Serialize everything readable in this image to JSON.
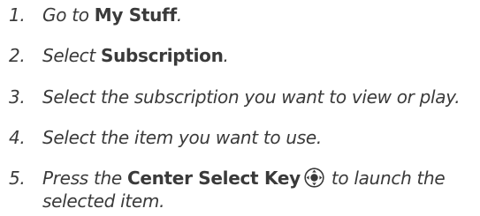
{
  "steps": [
    {
      "number": "1.",
      "pre": "Go to ",
      "bold": "My Stuff",
      "post": "."
    },
    {
      "number": "2.",
      "pre": "Select ",
      "bold": "Subscription",
      "post": "."
    },
    {
      "number": "3.",
      "text": "Select the subscription you want to view or play."
    },
    {
      "number": "4.",
      "text": "Select the item you want to use."
    },
    {
      "number": "5.",
      "pre": "Press the ",
      "bold": "Center Select Key",
      "icon": "center-select-key-icon",
      "post_line1": " to launch the",
      "post_line2": "selected item."
    }
  ]
}
